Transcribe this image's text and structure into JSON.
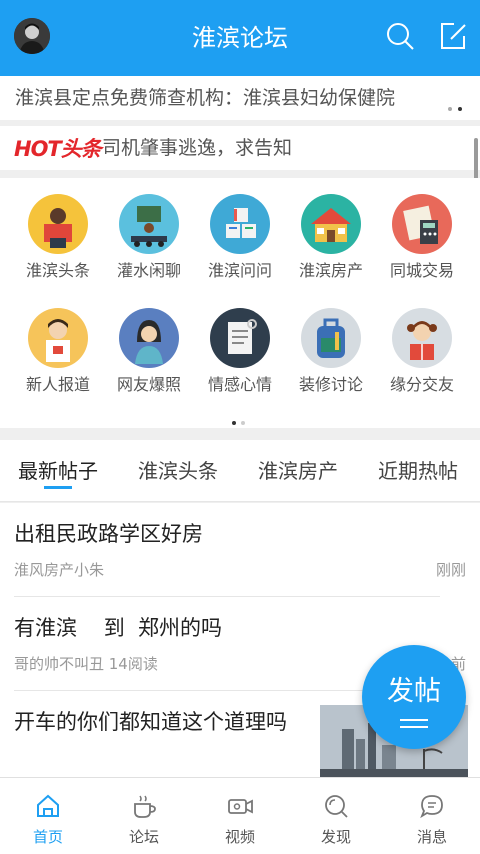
{
  "header": {
    "title": "淮滨论坛",
    "avatar_icon": "user-avatar",
    "search_icon": "search-icon",
    "compose_icon": "edit-icon"
  },
  "notice": {
    "text": "淮滨县定点免费筛查机构：淮滨县妇幼保健院"
  },
  "hot": {
    "logo": "HOT头条",
    "text": "司机肇事逃逸，求告知"
  },
  "categories": [
    {
      "label": "淮滨头条",
      "icon": "reading-person-icon",
      "color": "#f5c33b"
    },
    {
      "label": "灌水闲聊",
      "icon": "classroom-icon",
      "color": "#5bc0de"
    },
    {
      "label": "淮滨问问",
      "icon": "number-blocks-icon",
      "color": "#3fa9d6"
    },
    {
      "label": "淮滨房产",
      "icon": "house-icon",
      "color": "#2bb3a3"
    },
    {
      "label": "同城交易",
      "icon": "calculator-icon",
      "color": "#e8695a"
    },
    {
      "label": "新人报道",
      "icon": "newcomer-icon",
      "color": "#f6c45a"
    },
    {
      "label": "网友爆照",
      "icon": "woman-photo-icon",
      "color": "#5a7fc0"
    },
    {
      "label": "情感心情",
      "icon": "notepad-icon",
      "color": "#2f3e4d"
    },
    {
      "label": "装修讨论",
      "icon": "backpack-icon",
      "color": "#d5dbe0"
    },
    {
      "label": "缘分交友",
      "icon": "girl-book-icon",
      "color": "#d7dde2"
    }
  ],
  "tabs": [
    {
      "label": "最新帖子"
    },
    {
      "label": "淮滨头条"
    },
    {
      "label": "淮滨房产"
    },
    {
      "label": "近期热帖"
    }
  ],
  "posts": [
    {
      "title": "出租民政路学区好房",
      "meta": "淮风房产小朱",
      "time": "刚刚"
    },
    {
      "title": "有淮滨    到  郑州的吗",
      "meta": "哥的帅不叫丑   14阅读",
      "time": "前"
    },
    {
      "title": "开车的你们都知道这个道理吗",
      "meta": "",
      "time": ""
    }
  ],
  "fab": {
    "label": "发帖"
  },
  "bottom_nav": [
    {
      "label": "首页",
      "icon": "home-icon"
    },
    {
      "label": "论坛",
      "icon": "coffee-icon"
    },
    {
      "label": "视频",
      "icon": "video-icon"
    },
    {
      "label": "发现",
      "icon": "discover-icon"
    },
    {
      "label": "消息",
      "icon": "message-icon"
    }
  ],
  "colors": {
    "primary": "#1e9ff2",
    "hot_red": "#e3262b"
  }
}
